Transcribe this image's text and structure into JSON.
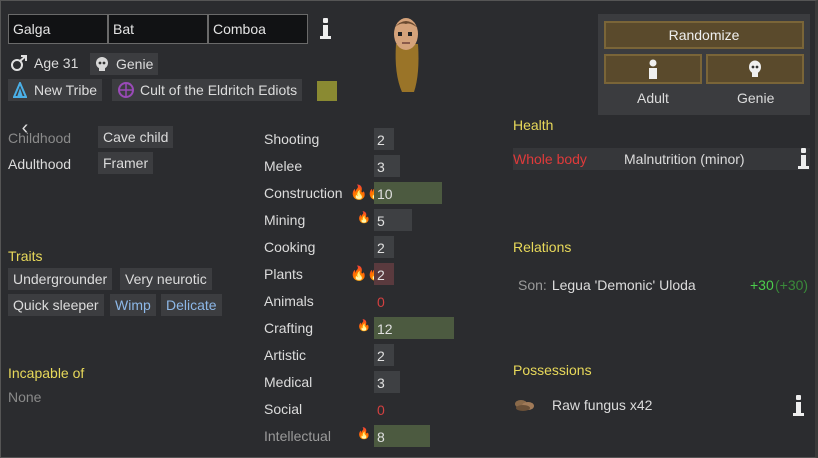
{
  "name": {
    "first": "Galga",
    "nick": "Bat",
    "last": "Comboa"
  },
  "age": "Age 31",
  "race": "Genie",
  "faction": "New Tribe",
  "ideology": "Cult of the Eldritch Ediots",
  "ideology_color": "#8a8a32",
  "gender_icon": "male-icon",
  "backstory": {
    "childhood_label": "Childhood",
    "childhood": "Cave child",
    "adulthood_label": "Adulthood",
    "adulthood": "Framer"
  },
  "traits": {
    "title": "Traits",
    "items": [
      "Undergrounder",
      "Very neurotic",
      "Quick sleeper",
      "Wimp",
      "Delicate"
    ]
  },
  "incapable": {
    "title": "Incapable of",
    "value": "None"
  },
  "skills": [
    {
      "name": "Shooting",
      "level": "2",
      "passion": 0,
      "fill": 0.1
    },
    {
      "name": "Melee",
      "level": "3",
      "passion": 0,
      "fill": 0.15
    },
    {
      "name": "Construction",
      "level": "10",
      "passion": 2,
      "fill": 0.5
    },
    {
      "name": "Mining",
      "level": "5",
      "passion": 1,
      "fill": 0.25
    },
    {
      "name": "Cooking",
      "level": "2",
      "passion": 0,
      "fill": 0.1
    },
    {
      "name": "Plants",
      "level": "2",
      "passion": 2,
      "fill": 0.1
    },
    {
      "name": "Animals",
      "level": "0",
      "passion": 0,
      "fill": 0
    },
    {
      "name": "Crafting",
      "level": "12",
      "passion": 1,
      "fill": 0.6
    },
    {
      "name": "Artistic",
      "level": "2",
      "passion": 0,
      "fill": 0.1
    },
    {
      "name": "Medical",
      "level": "3",
      "passion": 0,
      "fill": 0.15
    },
    {
      "name": "Social",
      "level": "0",
      "passion": 0,
      "fill": 0
    },
    {
      "name": "Intellectual",
      "level": "8",
      "passion": 1,
      "fill": 0.4
    }
  ],
  "randomize": {
    "label": "Randomize",
    "adult_label": "Adult",
    "genie_label": "Genie"
  },
  "health": {
    "title": "Health",
    "part": "Whole body",
    "condition": "Malnutrition (minor)",
    "part_color": "#e03a3a"
  },
  "relations": {
    "title": "Relations",
    "relation": "Son:",
    "name": "Legua 'Demonic' Uloda",
    "opinion": "+30",
    "opinion_other": "(+30)"
  },
  "possessions": {
    "title": "Possessions",
    "item": "Raw fungus x42"
  }
}
